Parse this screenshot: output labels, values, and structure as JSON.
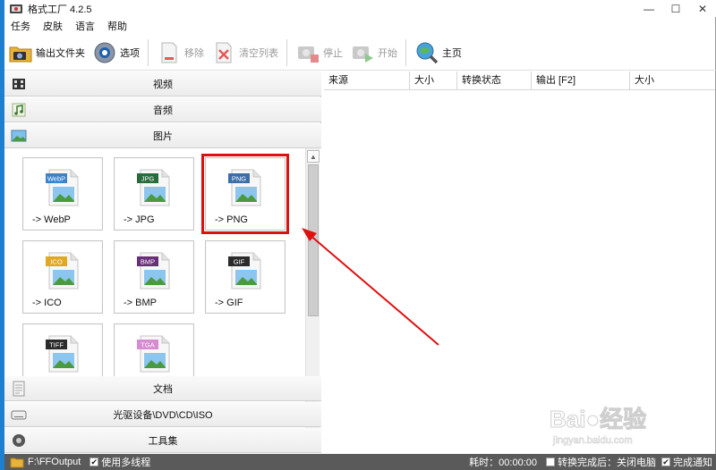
{
  "window": {
    "title": "格式工厂 4.2.5",
    "controls": [
      "—",
      "☐",
      "✕"
    ]
  },
  "menu": [
    "任务",
    "皮肤",
    "语言",
    "帮助"
  ],
  "toolbar": {
    "output_folder": "输出文件夹",
    "options": "选项",
    "remove": "移除",
    "clear_list": "清空列表",
    "stop": "停止",
    "start": "开始",
    "home": "主页"
  },
  "categories": {
    "video": "视频",
    "audio": "音频",
    "picture": "图片",
    "document": "文档",
    "optical": "光驱设备\\DVD\\CD\\ISO",
    "tools": "工具集"
  },
  "formats": [
    {
      "badge": "WebP",
      "label": "-> WebP",
      "color": "#3d82c7"
    },
    {
      "badge": "JPG",
      "label": "-> JPG",
      "color": "#2a6b3c"
    },
    {
      "badge": "PNG",
      "label": "-> PNG",
      "color": "#3b6ea8"
    },
    {
      "badge": "ICO",
      "label": "-> ICO",
      "color": "#e0a91e"
    },
    {
      "badge": "BMP",
      "label": "-> BMP",
      "color": "#6a2f7a"
    },
    {
      "badge": "GIF",
      "label": "-> GIF",
      "color": "#2b2b2b"
    },
    {
      "badge": "TIFF",
      "label": "",
      "color": "#2b2b2b"
    },
    {
      "badge": "TGA",
      "label": "",
      "color": "#d78bd0"
    }
  ],
  "highlighted_format": "PNG",
  "table_headers": [
    "来源",
    "大小",
    "转换状态",
    "输出 [F2]",
    "大小"
  ],
  "status": {
    "output_path": "F:\\FFOutput",
    "multithread": "使用多线程",
    "elapsed": "耗时：00:00:00",
    "after_done": "转换完成后：关闭电脑",
    "notify": "完成通知"
  },
  "watermark": {
    "brand": "Bai●经验",
    "url": "jingyan.baidu.com"
  },
  "colors": {
    "accent_red": "#e01010",
    "statusbar_bg": "#5a5a5a",
    "left_strip": "#1e7fcf"
  }
}
